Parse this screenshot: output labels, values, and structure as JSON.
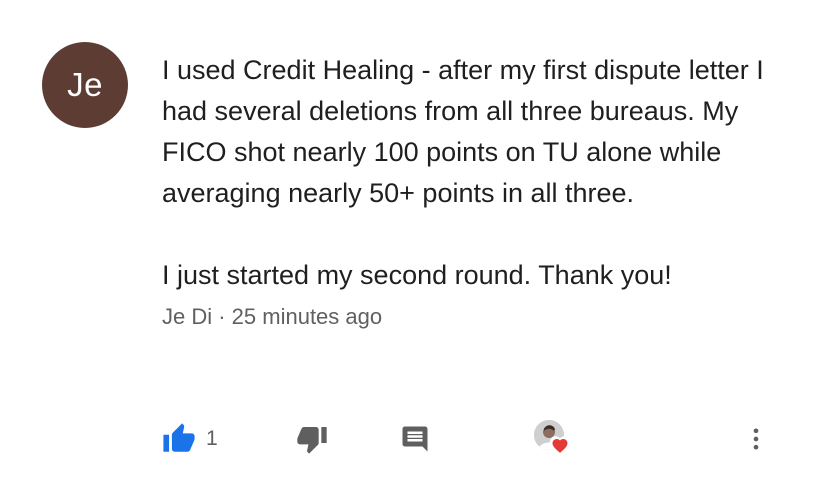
{
  "avatar": {
    "initials": "Je",
    "bg_color": "#5d3d33"
  },
  "comment": {
    "paragraphs": [
      "I used Credit Healing - after my first dispute letter I had several deletions from all three bureaus. My FICO shot nearly 100 points on TU alone while averaging nearly 50+ points in all three.",
      "I just started my second round. Thank you!"
    ],
    "meta": "Je Di · 25 minutes ago"
  },
  "actions": {
    "like_count": "1",
    "like_color": "#1a73e8",
    "icon_color": "#5f5f5f",
    "heart_color": "#e53935"
  }
}
